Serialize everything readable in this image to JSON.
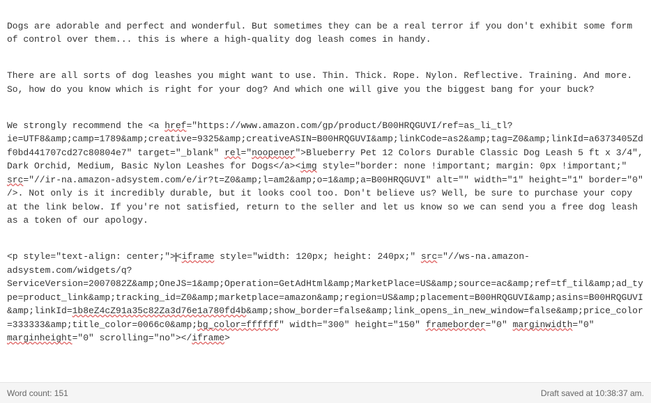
{
  "editor": {
    "para1": "Dogs are adorable and perfect and wonderful. But sometimes they can be a real terror if you don't exhibit some form of control over them... this is where a high-quality dog leash comes in handy.",
    "para2": "There are all sorts of dog leashes you might want to use. Thin. Thick. Rope. Nylon. Reflective. Training. And more. So, how do you know which is right for your dog? And which one will give you the biggest bang for your buck?",
    "para3_a": "We strongly recommend the <a ",
    "para3_href": "href",
    "para3_b": "=\"https://www.amazon.com/gp/product/B00HRQGUVI/ref=as_li_tl?ie=UTF8&amp;camp=1789&amp;creative=9325&amp;creativeASIN=B00HRQGUVI&amp;linkCode=as2&amp;tag=Z0&amp;linkId=a6373405Zdf0bd441707cd27c80804e7\" target=\"_blank\" ",
    "para3_rel": "rel",
    "para3_c": "=\"",
    "para3_noopener": "noopener",
    "para3_d": "\">Blueberry Pet 12 Colors Durable Classic Dog Leash 5 ft x 3/4\", Dark Orchid, Medium, Basic Nylon Leashes for Dogs</a><",
    "para3_img": "img",
    "para3_e": " style=\"border: none !important; margin: 0px !important;\" ",
    "para3_src": "src",
    "para3_f": "=\"//ir-na.amazon-adsystem.com/e/ir?t=Z0&amp;l=am2&amp;o=1&amp;a=B00HRQGUVI\" alt=\"\" width=\"1\" height=\"1\" border=\"0\" />. Not only is it incredibly durable, but it looks cool too. Don't believe us? Well, be sure to purchase your copy at the link below. If you're not satisfied, return to the seller and let us know so we can send you a free dog leash as a token of our apology.",
    "para4_a": "<p style=\"text-align: center;\">",
    "para4_b": "<",
    "para4_iframe": "iframe",
    "para4_c": " style=\"width: 120px; height: 240px;\" ",
    "para4_src": "src",
    "para4_d": "=\"//ws-na.amazon-adsystem.com/widgets/q?ServiceVersion=2007082Z&amp;OneJS=1&amp;Operation=GetAdHtml&amp;MarketPlace=US&amp;source=ac&amp;ref=tf_til&amp;ad_type=product_link&amp;tracking_id=Z0&amp;marketplace=amazon&amp;region=US&amp;placement=B00HRQGUVI&amp;asins=B00HRQGUVI&amp;linkId=",
    "para4_linkid": "1b8eZ4cZ91a35c82Za3d76e1a780fd4b",
    "para4_e": "&amp;show_border=false&amp;link_opens_in_new_window=false&amp;price_color=333333&amp;title_color=0066c0&amp;",
    "para4_bgcolor": "bg_color=ffffff",
    "para4_f": "\" width=\"300\" height=\"150\" ",
    "para4_frameborder": "frameborder",
    "para4_g": "=\"0\" ",
    "para4_marginwidth": "marginwidth",
    "para4_h": "=\"0\" ",
    "para4_marginheight": "marginheight",
    "para4_i": "=\"0\" scrolling=\"no\"></",
    "para4_iframe2": "iframe",
    "para4_j": ">"
  },
  "status": {
    "word_count_label": "Word count: 151",
    "draft_saved_label": "Draft saved at 10:38:37 am."
  }
}
